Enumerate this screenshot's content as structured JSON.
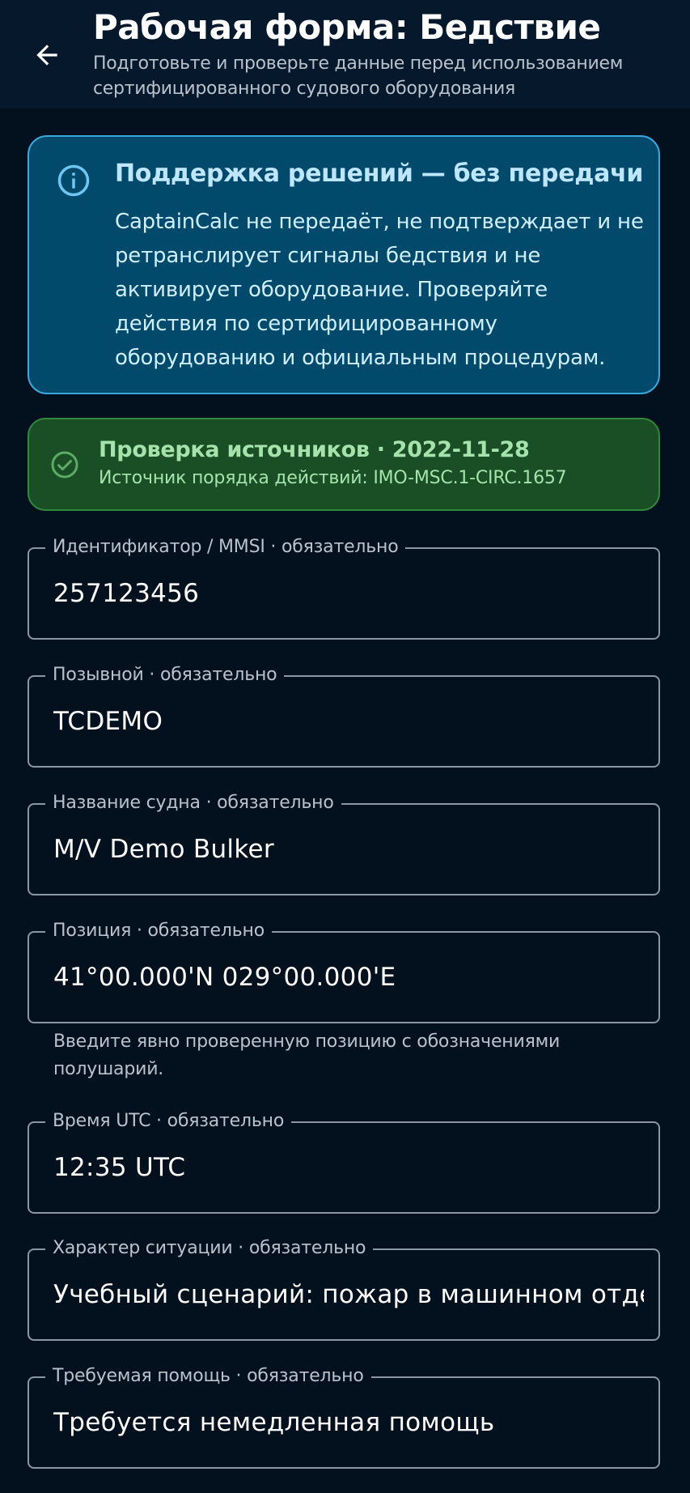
{
  "header": {
    "title": "Рабочая форма: Бедствие",
    "subtitle": "Подготовьте и проверьте данные перед использованием сертифицированного судового оборудования",
    "back_icon": "arrow-left-icon"
  },
  "info_card": {
    "icon": "info-icon",
    "title": "Поддержка решений — без передачи",
    "body": "CaptainCalc не передаёт, не подтверждает и не ретранслирует сигналы бедствия и не активирует оборудование. Проверяйте действия по сертифицированному оборудованию и официальным процедурам.",
    "background": "#024a6c",
    "border": "#3aa8dc"
  },
  "source_card": {
    "icon": "check-circle-icon",
    "title": "Проверка источников · 2022-11-28",
    "subtitle": "Источник порядка действий: IMO-MSC.1-CIRC.1657",
    "background": "#1a4e24",
    "border": "#2f8a3c"
  },
  "fields": {
    "mmsi": {
      "label": "Идентификатор / MMSI · обязательно",
      "value": "257123456"
    },
    "callsign": {
      "label": "Позывной · обязательно",
      "value": "TCDEMO"
    },
    "vessel_name": {
      "label": "Название судна · обязательно",
      "value": "M/V Demo Bulker"
    },
    "position": {
      "label": "Позиция · обязательно",
      "value": "41°00.000'N 029°00.000'E",
      "helper": "Введите явно проверенную позицию с обозначениями полушарий."
    },
    "utc_time": {
      "label": "Время UTC · обязательно",
      "value": "12:35 UTC"
    },
    "nature": {
      "label": "Характер ситуации · обязательно",
      "value": "Учебный сценарий: пожар в машинном отделении"
    },
    "assistance": {
      "label": "Требуемая помощь · обязательно",
      "value": "Требуется немедленная помощь"
    }
  }
}
